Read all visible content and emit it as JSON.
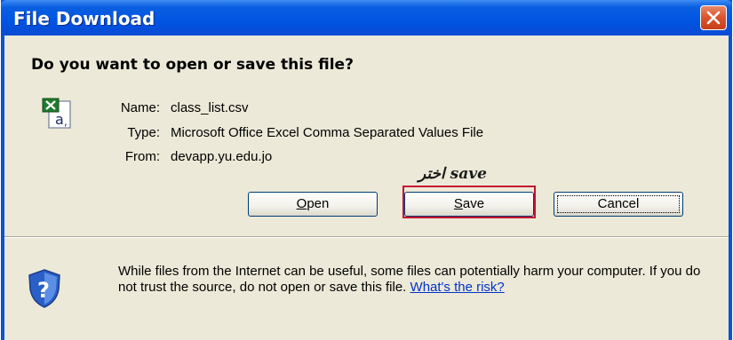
{
  "window": {
    "title": "File Download"
  },
  "dialog": {
    "question": "Do you want to open or save this file?",
    "file": {
      "name_label": "Name:",
      "name_value": "class_list.csv",
      "type_label": "Type:",
      "type_value": "Microsoft Office Excel Comma Separated Values File",
      "from_label": "From:",
      "from_value": "devapp.yu.edu.jo",
      "icon": "excel-csv-file-icon"
    },
    "annotation": "اختر save",
    "buttons": {
      "open_mnemonic": "O",
      "open_rest": "pen",
      "save_mnemonic": "S",
      "save_rest": "ave",
      "cancel": "Cancel"
    },
    "warning": {
      "icon": "security-shield-question-icon",
      "text": "While files from the Internet can be useful, some files can potentially harm your computer. If you do not trust the source, do not open or save this file.",
      "link": "What's the risk?"
    }
  },
  "colors": {
    "titlebar": "#0054e3",
    "dialog_bg": "#ece9d8",
    "highlight": "#c8102e",
    "link": "#0033cc"
  }
}
